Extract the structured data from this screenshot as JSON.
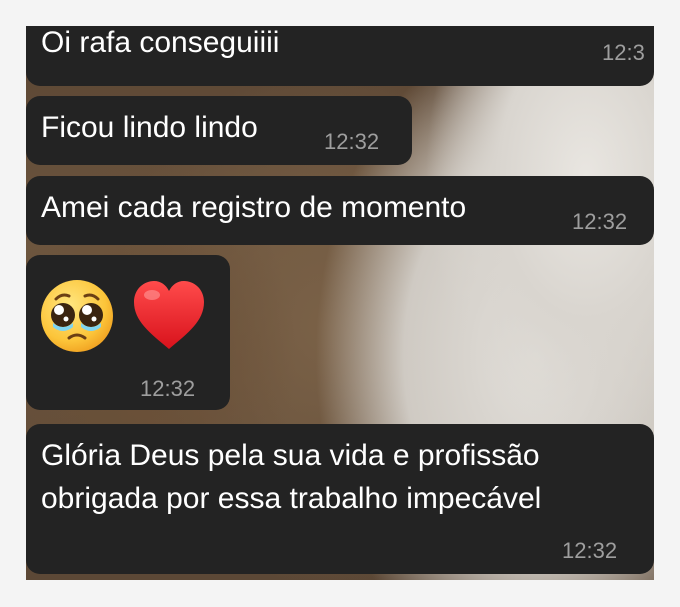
{
  "messages": [
    {
      "text": "Oi rafa conseguiiii",
      "time": "12:3"
    },
    {
      "text": "Ficou lindo lindo",
      "time": "12:32"
    },
    {
      "text": "Amei cada registro de momento",
      "time": "12:32"
    },
    {
      "emojis": [
        "pleading-face",
        "red-heart"
      ],
      "time": "12:32"
    },
    {
      "lines": [
        "Glória Deus pela sua vida e profissão",
        "obrigada por essa trabalho impecável"
      ],
      "time": "12:32"
    }
  ],
  "colors": {
    "bubble": "#232323",
    "text": "#ffffff",
    "timestamp": "#9e9e9e"
  }
}
